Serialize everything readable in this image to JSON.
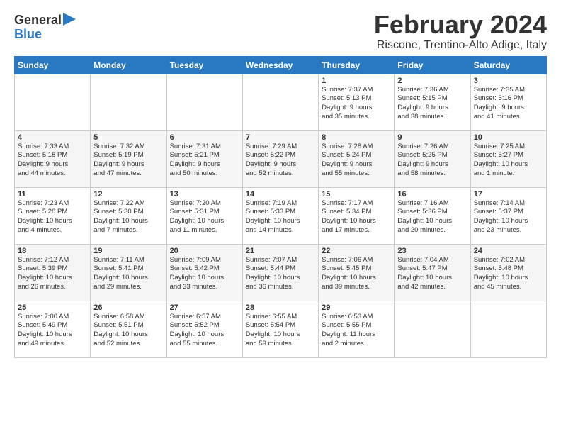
{
  "header": {
    "logo_line1": "General",
    "logo_line2": "Blue",
    "month_year": "February 2024",
    "location": "Riscone, Trentino-Alto Adige, Italy"
  },
  "days_of_week": [
    "Sunday",
    "Monday",
    "Tuesday",
    "Wednesday",
    "Thursday",
    "Friday",
    "Saturday"
  ],
  "weeks": [
    [
      {
        "day": "",
        "info": ""
      },
      {
        "day": "",
        "info": ""
      },
      {
        "day": "",
        "info": ""
      },
      {
        "day": "",
        "info": ""
      },
      {
        "day": "1",
        "info": "Sunrise: 7:37 AM\nSunset: 5:13 PM\nDaylight: 9 hours\nand 35 minutes."
      },
      {
        "day": "2",
        "info": "Sunrise: 7:36 AM\nSunset: 5:15 PM\nDaylight: 9 hours\nand 38 minutes."
      },
      {
        "day": "3",
        "info": "Sunrise: 7:35 AM\nSunset: 5:16 PM\nDaylight: 9 hours\nand 41 minutes."
      }
    ],
    [
      {
        "day": "4",
        "info": "Sunrise: 7:33 AM\nSunset: 5:18 PM\nDaylight: 9 hours\nand 44 minutes."
      },
      {
        "day": "5",
        "info": "Sunrise: 7:32 AM\nSunset: 5:19 PM\nDaylight: 9 hours\nand 47 minutes."
      },
      {
        "day": "6",
        "info": "Sunrise: 7:31 AM\nSunset: 5:21 PM\nDaylight: 9 hours\nand 50 minutes."
      },
      {
        "day": "7",
        "info": "Sunrise: 7:29 AM\nSunset: 5:22 PM\nDaylight: 9 hours\nand 52 minutes."
      },
      {
        "day": "8",
        "info": "Sunrise: 7:28 AM\nSunset: 5:24 PM\nDaylight: 9 hours\nand 55 minutes."
      },
      {
        "day": "9",
        "info": "Sunrise: 7:26 AM\nSunset: 5:25 PM\nDaylight: 9 hours\nand 58 minutes."
      },
      {
        "day": "10",
        "info": "Sunrise: 7:25 AM\nSunset: 5:27 PM\nDaylight: 10 hours\nand 1 minute."
      }
    ],
    [
      {
        "day": "11",
        "info": "Sunrise: 7:23 AM\nSunset: 5:28 PM\nDaylight: 10 hours\nand 4 minutes."
      },
      {
        "day": "12",
        "info": "Sunrise: 7:22 AM\nSunset: 5:30 PM\nDaylight: 10 hours\nand 7 minutes."
      },
      {
        "day": "13",
        "info": "Sunrise: 7:20 AM\nSunset: 5:31 PM\nDaylight: 10 hours\nand 11 minutes."
      },
      {
        "day": "14",
        "info": "Sunrise: 7:19 AM\nSunset: 5:33 PM\nDaylight: 10 hours\nand 14 minutes."
      },
      {
        "day": "15",
        "info": "Sunrise: 7:17 AM\nSunset: 5:34 PM\nDaylight: 10 hours\nand 17 minutes."
      },
      {
        "day": "16",
        "info": "Sunrise: 7:16 AM\nSunset: 5:36 PM\nDaylight: 10 hours\nand 20 minutes."
      },
      {
        "day": "17",
        "info": "Sunrise: 7:14 AM\nSunset: 5:37 PM\nDaylight: 10 hours\nand 23 minutes."
      }
    ],
    [
      {
        "day": "18",
        "info": "Sunrise: 7:12 AM\nSunset: 5:39 PM\nDaylight: 10 hours\nand 26 minutes."
      },
      {
        "day": "19",
        "info": "Sunrise: 7:11 AM\nSunset: 5:41 PM\nDaylight: 10 hours\nand 29 minutes."
      },
      {
        "day": "20",
        "info": "Sunrise: 7:09 AM\nSunset: 5:42 PM\nDaylight: 10 hours\nand 33 minutes."
      },
      {
        "day": "21",
        "info": "Sunrise: 7:07 AM\nSunset: 5:44 PM\nDaylight: 10 hours\nand 36 minutes."
      },
      {
        "day": "22",
        "info": "Sunrise: 7:06 AM\nSunset: 5:45 PM\nDaylight: 10 hours\nand 39 minutes."
      },
      {
        "day": "23",
        "info": "Sunrise: 7:04 AM\nSunset: 5:47 PM\nDaylight: 10 hours\nand 42 minutes."
      },
      {
        "day": "24",
        "info": "Sunrise: 7:02 AM\nSunset: 5:48 PM\nDaylight: 10 hours\nand 45 minutes."
      }
    ],
    [
      {
        "day": "25",
        "info": "Sunrise: 7:00 AM\nSunset: 5:49 PM\nDaylight: 10 hours\nand 49 minutes."
      },
      {
        "day": "26",
        "info": "Sunrise: 6:58 AM\nSunset: 5:51 PM\nDaylight: 10 hours\nand 52 minutes."
      },
      {
        "day": "27",
        "info": "Sunrise: 6:57 AM\nSunset: 5:52 PM\nDaylight: 10 hours\nand 55 minutes."
      },
      {
        "day": "28",
        "info": "Sunrise: 6:55 AM\nSunset: 5:54 PM\nDaylight: 10 hours\nand 59 minutes."
      },
      {
        "day": "29",
        "info": "Sunrise: 6:53 AM\nSunset: 5:55 PM\nDaylight: 11 hours\nand 2 minutes."
      },
      {
        "day": "",
        "info": ""
      },
      {
        "day": "",
        "info": ""
      }
    ]
  ]
}
